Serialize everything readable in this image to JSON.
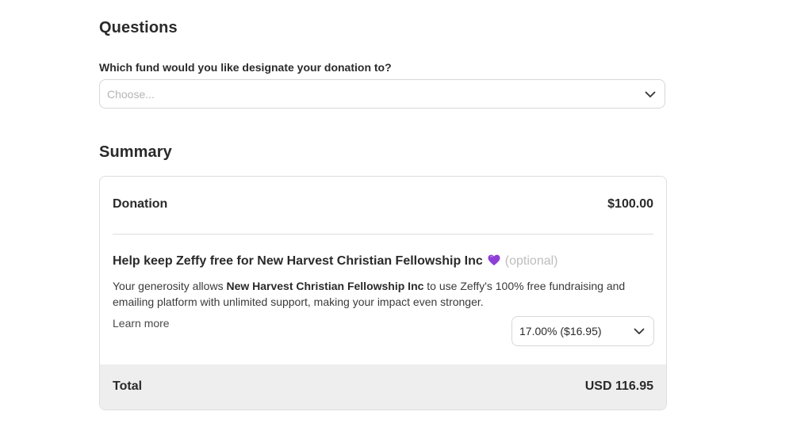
{
  "questions": {
    "title": "Questions",
    "fund_question": "Which fund would you like designate your donation to?",
    "fund_placeholder": "Choose..."
  },
  "summary": {
    "title": "Summary",
    "donation_label": "Donation",
    "donation_amount": "$100.00",
    "tip_heading": "Help keep Zeffy free for New Harvest Christian Fellowship Inc",
    "tip_optional": "(optional)",
    "tip_desc_prefix": "Your generosity allows ",
    "tip_desc_org": "New Harvest Christian Fellowship Inc",
    "tip_desc_suffix": " to use Zeffy's 100% free fundraising and emailing platform with unlimited support, making your impact even stronger.",
    "learn_more": "Learn more",
    "tip_selected": "17.00% ($16.95)",
    "total_label": "Total",
    "total_amount": "USD 116.95"
  },
  "icons": {
    "heart": "purple-heart-icon",
    "dropdown": "chevron-down-icon"
  },
  "colors": {
    "heart": "#8e3fd6",
    "total_bar": "#eeeeee",
    "placeholder": "#b4b4b4",
    "optional_text": "#bdbdbd"
  }
}
